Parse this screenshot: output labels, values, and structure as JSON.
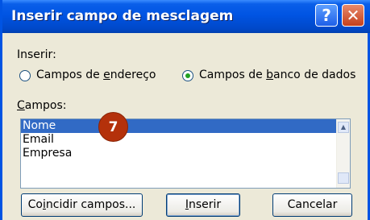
{
  "dialog": {
    "title": "Inserir campo de mesclagem",
    "help_glyph": "?",
    "close_glyph": "✕"
  },
  "insert_section": {
    "label": "Inserir:",
    "options": [
      {
        "label_pre": "Campos de ",
        "label_key": "e",
        "label_post": "ndereço",
        "checked": false
      },
      {
        "label_pre": "Campos de ",
        "label_key": "b",
        "label_post": "anco de dados",
        "checked": true
      }
    ]
  },
  "fields_section": {
    "label_key": "C",
    "label_rest": "ampos:",
    "items": [
      "Nome",
      "Email",
      "Empresa"
    ],
    "selected_index": 0
  },
  "annotation": {
    "step_number": "7",
    "color": "#b4310b"
  },
  "buttons": {
    "match": {
      "pre": "Co",
      "key": "i",
      "post": "ncidir campos..."
    },
    "insert": {
      "pre": "",
      "key": "I",
      "post": "nserir"
    },
    "cancel": {
      "label": "Cancelar"
    }
  },
  "colors": {
    "title_bar": "#0054e3",
    "dialog_face": "#ece9d8",
    "selection": "#316ac5"
  }
}
